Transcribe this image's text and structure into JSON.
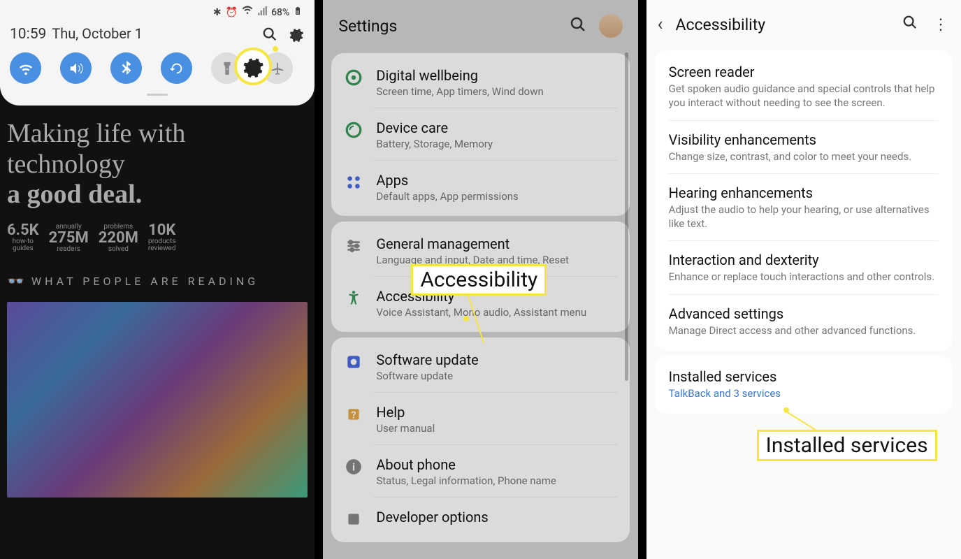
{
  "panel1": {
    "status_bar": {
      "icons_text": "68%",
      "bluetooth": "✱",
      "alarm": "⏰"
    },
    "time": "10:59",
    "date": "Thu, October 1",
    "quick_toggles": [
      {
        "name": "wifi",
        "active": true
      },
      {
        "name": "sound",
        "active": true
      },
      {
        "name": "bluetooth",
        "active": true
      },
      {
        "name": "rotate",
        "active": true
      },
      {
        "name": "flashlight",
        "active": false
      },
      {
        "name": "airplane",
        "active": false
      }
    ],
    "article": {
      "headline_plain": "Making life with technology",
      "headline_bold": "a good deal.",
      "stats": [
        {
          "big": "6.5K",
          "small": "how-to",
          "small2": "guides"
        },
        {
          "annually": "annually",
          "big": "275M",
          "small": "readers"
        },
        {
          "annually": "problems",
          "big": "220M",
          "small": "solved"
        },
        {
          "big": "10K",
          "small": "products",
          "small2": "reviewed"
        }
      ],
      "reading_label": "WHAT PEOPLE ARE READING"
    }
  },
  "panel2": {
    "title": "Settings",
    "groups": [
      {
        "items": [
          {
            "icon": "wellbeing",
            "title": "Digital wellbeing",
            "sub": "Screen time, App timers, Wind down"
          },
          {
            "icon": "devicecare",
            "title": "Device care",
            "sub": "Battery, Storage, Memory"
          },
          {
            "icon": "apps",
            "title": "Apps",
            "sub": "Default apps, App permissions"
          }
        ]
      },
      {
        "items": [
          {
            "icon": "general",
            "title": "General management",
            "sub": "Language and input, Date and time, Reset"
          },
          {
            "icon": "accessibility",
            "title": "Accessibility",
            "sub": "Voice Assistant, Mono audio, Assistant menu"
          }
        ]
      },
      {
        "items": [
          {
            "icon": "update",
            "title": "Software update",
            "sub": "Software update"
          },
          {
            "icon": "help",
            "title": "Help",
            "sub": "User manual"
          },
          {
            "icon": "about",
            "title": "About phone",
            "sub": "Status, Legal information, Phone name"
          },
          {
            "icon": "dev",
            "title": "Developer options",
            "sub": ""
          }
        ]
      }
    ],
    "callout": "Accessibility"
  },
  "panel3": {
    "title": "Accessibility",
    "groups": [
      {
        "items": [
          {
            "title": "Screen reader",
            "sub": "Get spoken audio guidance and special controls that help you interact without needing to see the screen."
          },
          {
            "title": "Visibility enhancements",
            "sub": "Change size, contrast, and color to meet your needs."
          },
          {
            "title": "Hearing enhancements",
            "sub": "Adjust the audio to help your hearing, or use alternatives like text."
          },
          {
            "title": "Interaction and dexterity",
            "sub": "Enhance or replace touch interactions and other controls."
          },
          {
            "title": "Advanced settings",
            "sub": "Manage Direct access and other advanced functions."
          }
        ]
      },
      {
        "items": [
          {
            "title": "Installed services",
            "sub": "TalkBack and 3 services",
            "link": true
          }
        ]
      }
    ],
    "callout": "Installed services"
  }
}
